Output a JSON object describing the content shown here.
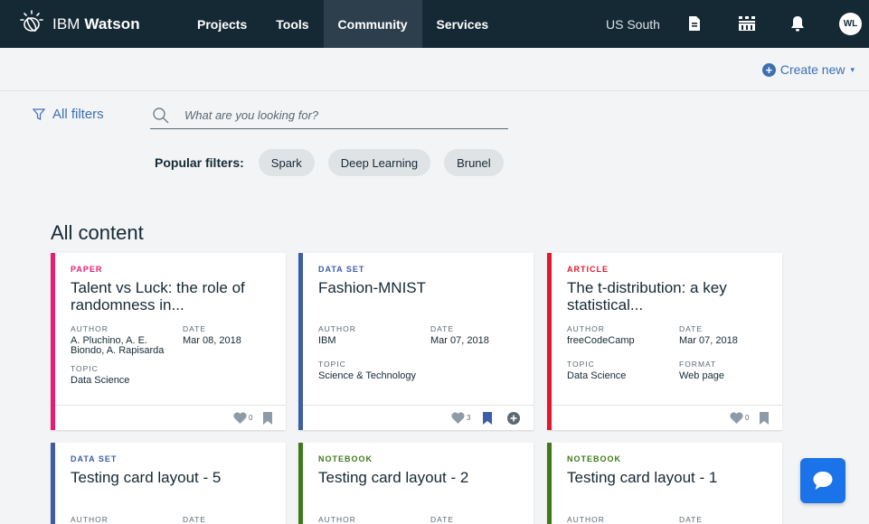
{
  "brand": {
    "name_light": "IBM ",
    "name_bold": "Watson"
  },
  "nav": {
    "items": [
      "Projects",
      "Tools",
      "Community",
      "Services"
    ],
    "active": "Community"
  },
  "header": {
    "region": "US South",
    "avatar_initials": "WL"
  },
  "subbar": {
    "create_new": "Create new"
  },
  "filters": {
    "all_filters": "All filters",
    "search_placeholder": "What are you looking for?",
    "popular_label": "Popular filters:",
    "popular": [
      "Spark",
      "Deep Learning",
      "Brunel"
    ]
  },
  "content": {
    "title": "All content",
    "cards": [
      {
        "type": "PAPER",
        "title": "Talent vs Luck: the role of randomness in...",
        "author_label": "AUTHOR",
        "author": "A. Pluchino, A. E. Biondo, A. Rapisarda",
        "date_label": "DATE",
        "date": "Mar 08, 2018",
        "c_label": "TOPIC",
        "c": "Data Science",
        "likes": "0"
      },
      {
        "type": "DATA SET",
        "title": "Fashion-MNIST",
        "author_label": "AUTHOR",
        "author": "IBM",
        "date_label": "DATE",
        "date": "Mar 07, 2018",
        "c_label": "TOPIC",
        "c": "Science & Technology",
        "likes": "3"
      },
      {
        "type": "ARTICLE",
        "title": "The t-distribution: a key statistical...",
        "author_label": "AUTHOR",
        "author": "freeCodeCamp",
        "date_label": "DATE",
        "date": "Mar 07, 2018",
        "c_label": "TOPIC",
        "c": "Data Science",
        "d_label": "FORMAT",
        "d": "Web page",
        "likes": "0"
      },
      {
        "type": "DATA SET",
        "title": "Testing card layout - 5",
        "author_label": "AUTHOR",
        "date_label": "DATE"
      },
      {
        "type": "NOTEBOOK",
        "title": "Testing card layout - 2",
        "author_label": "AUTHOR",
        "date_label": "DATE"
      },
      {
        "type": "NOTEBOOK",
        "title": "Testing card layout - 1",
        "author_label": "AUTHOR",
        "date_label": "DATE"
      }
    ]
  },
  "colors": {
    "paper": "#e71d73",
    "data_set": "#3d5da8",
    "article": "#e0182d",
    "notebook": "#3f7a1a",
    "link": "#3d70b2",
    "topbar": "#152935"
  },
  "icons": [
    "watson-logo-icon",
    "filter-icon",
    "search-icon",
    "document-icon",
    "catalog-icon",
    "bell-icon",
    "heart-icon",
    "bookmark-icon",
    "add-icon",
    "chat-icon"
  ]
}
